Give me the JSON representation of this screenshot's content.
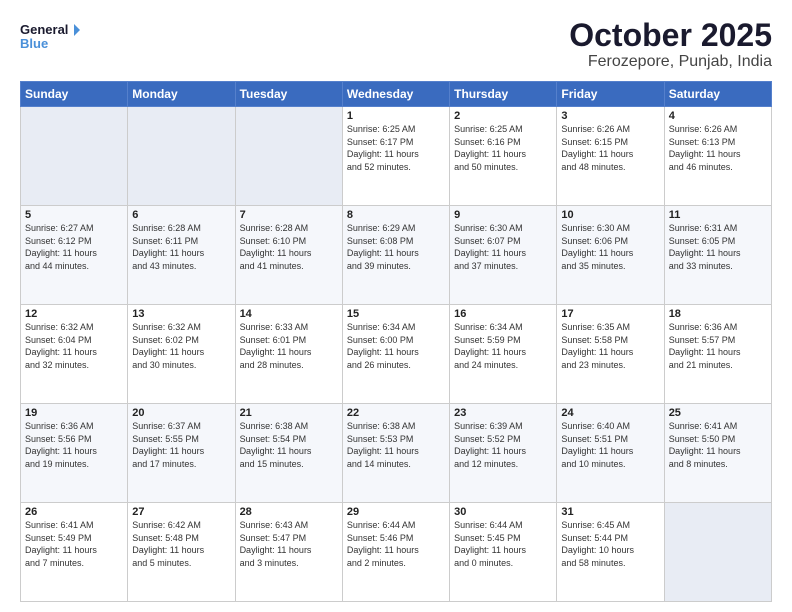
{
  "header": {
    "logo_line1": "General",
    "logo_line2": "Blue",
    "title": "October 2025",
    "subtitle": "Ferozepore, Punjab, India"
  },
  "weekdays": [
    "Sunday",
    "Monday",
    "Tuesday",
    "Wednesday",
    "Thursday",
    "Friday",
    "Saturday"
  ],
  "rows": [
    [
      {
        "num": "",
        "info": ""
      },
      {
        "num": "",
        "info": ""
      },
      {
        "num": "",
        "info": ""
      },
      {
        "num": "1",
        "info": "Sunrise: 6:25 AM\nSunset: 6:17 PM\nDaylight: 11 hours\nand 52 minutes."
      },
      {
        "num": "2",
        "info": "Sunrise: 6:25 AM\nSunset: 6:16 PM\nDaylight: 11 hours\nand 50 minutes."
      },
      {
        "num": "3",
        "info": "Sunrise: 6:26 AM\nSunset: 6:15 PM\nDaylight: 11 hours\nand 48 minutes."
      },
      {
        "num": "4",
        "info": "Sunrise: 6:26 AM\nSunset: 6:13 PM\nDaylight: 11 hours\nand 46 minutes."
      }
    ],
    [
      {
        "num": "5",
        "info": "Sunrise: 6:27 AM\nSunset: 6:12 PM\nDaylight: 11 hours\nand 44 minutes."
      },
      {
        "num": "6",
        "info": "Sunrise: 6:28 AM\nSunset: 6:11 PM\nDaylight: 11 hours\nand 43 minutes."
      },
      {
        "num": "7",
        "info": "Sunrise: 6:28 AM\nSunset: 6:10 PM\nDaylight: 11 hours\nand 41 minutes."
      },
      {
        "num": "8",
        "info": "Sunrise: 6:29 AM\nSunset: 6:08 PM\nDaylight: 11 hours\nand 39 minutes."
      },
      {
        "num": "9",
        "info": "Sunrise: 6:30 AM\nSunset: 6:07 PM\nDaylight: 11 hours\nand 37 minutes."
      },
      {
        "num": "10",
        "info": "Sunrise: 6:30 AM\nSunset: 6:06 PM\nDaylight: 11 hours\nand 35 minutes."
      },
      {
        "num": "11",
        "info": "Sunrise: 6:31 AM\nSunset: 6:05 PM\nDaylight: 11 hours\nand 33 minutes."
      }
    ],
    [
      {
        "num": "12",
        "info": "Sunrise: 6:32 AM\nSunset: 6:04 PM\nDaylight: 11 hours\nand 32 minutes."
      },
      {
        "num": "13",
        "info": "Sunrise: 6:32 AM\nSunset: 6:02 PM\nDaylight: 11 hours\nand 30 minutes."
      },
      {
        "num": "14",
        "info": "Sunrise: 6:33 AM\nSunset: 6:01 PM\nDaylight: 11 hours\nand 28 minutes."
      },
      {
        "num": "15",
        "info": "Sunrise: 6:34 AM\nSunset: 6:00 PM\nDaylight: 11 hours\nand 26 minutes."
      },
      {
        "num": "16",
        "info": "Sunrise: 6:34 AM\nSunset: 5:59 PM\nDaylight: 11 hours\nand 24 minutes."
      },
      {
        "num": "17",
        "info": "Sunrise: 6:35 AM\nSunset: 5:58 PM\nDaylight: 11 hours\nand 23 minutes."
      },
      {
        "num": "18",
        "info": "Sunrise: 6:36 AM\nSunset: 5:57 PM\nDaylight: 11 hours\nand 21 minutes."
      }
    ],
    [
      {
        "num": "19",
        "info": "Sunrise: 6:36 AM\nSunset: 5:56 PM\nDaylight: 11 hours\nand 19 minutes."
      },
      {
        "num": "20",
        "info": "Sunrise: 6:37 AM\nSunset: 5:55 PM\nDaylight: 11 hours\nand 17 minutes."
      },
      {
        "num": "21",
        "info": "Sunrise: 6:38 AM\nSunset: 5:54 PM\nDaylight: 11 hours\nand 15 minutes."
      },
      {
        "num": "22",
        "info": "Sunrise: 6:38 AM\nSunset: 5:53 PM\nDaylight: 11 hours\nand 14 minutes."
      },
      {
        "num": "23",
        "info": "Sunrise: 6:39 AM\nSunset: 5:52 PM\nDaylight: 11 hours\nand 12 minutes."
      },
      {
        "num": "24",
        "info": "Sunrise: 6:40 AM\nSunset: 5:51 PM\nDaylight: 11 hours\nand 10 minutes."
      },
      {
        "num": "25",
        "info": "Sunrise: 6:41 AM\nSunset: 5:50 PM\nDaylight: 11 hours\nand 8 minutes."
      }
    ],
    [
      {
        "num": "26",
        "info": "Sunrise: 6:41 AM\nSunset: 5:49 PM\nDaylight: 11 hours\nand 7 minutes."
      },
      {
        "num": "27",
        "info": "Sunrise: 6:42 AM\nSunset: 5:48 PM\nDaylight: 11 hours\nand 5 minutes."
      },
      {
        "num": "28",
        "info": "Sunrise: 6:43 AM\nSunset: 5:47 PM\nDaylight: 11 hours\nand 3 minutes."
      },
      {
        "num": "29",
        "info": "Sunrise: 6:44 AM\nSunset: 5:46 PM\nDaylight: 11 hours\nand 2 minutes."
      },
      {
        "num": "30",
        "info": "Sunrise: 6:44 AM\nSunset: 5:45 PM\nDaylight: 11 hours\nand 0 minutes."
      },
      {
        "num": "31",
        "info": "Sunrise: 6:45 AM\nSunset: 5:44 PM\nDaylight: 10 hours\nand 58 minutes."
      },
      {
        "num": "",
        "info": ""
      }
    ]
  ]
}
